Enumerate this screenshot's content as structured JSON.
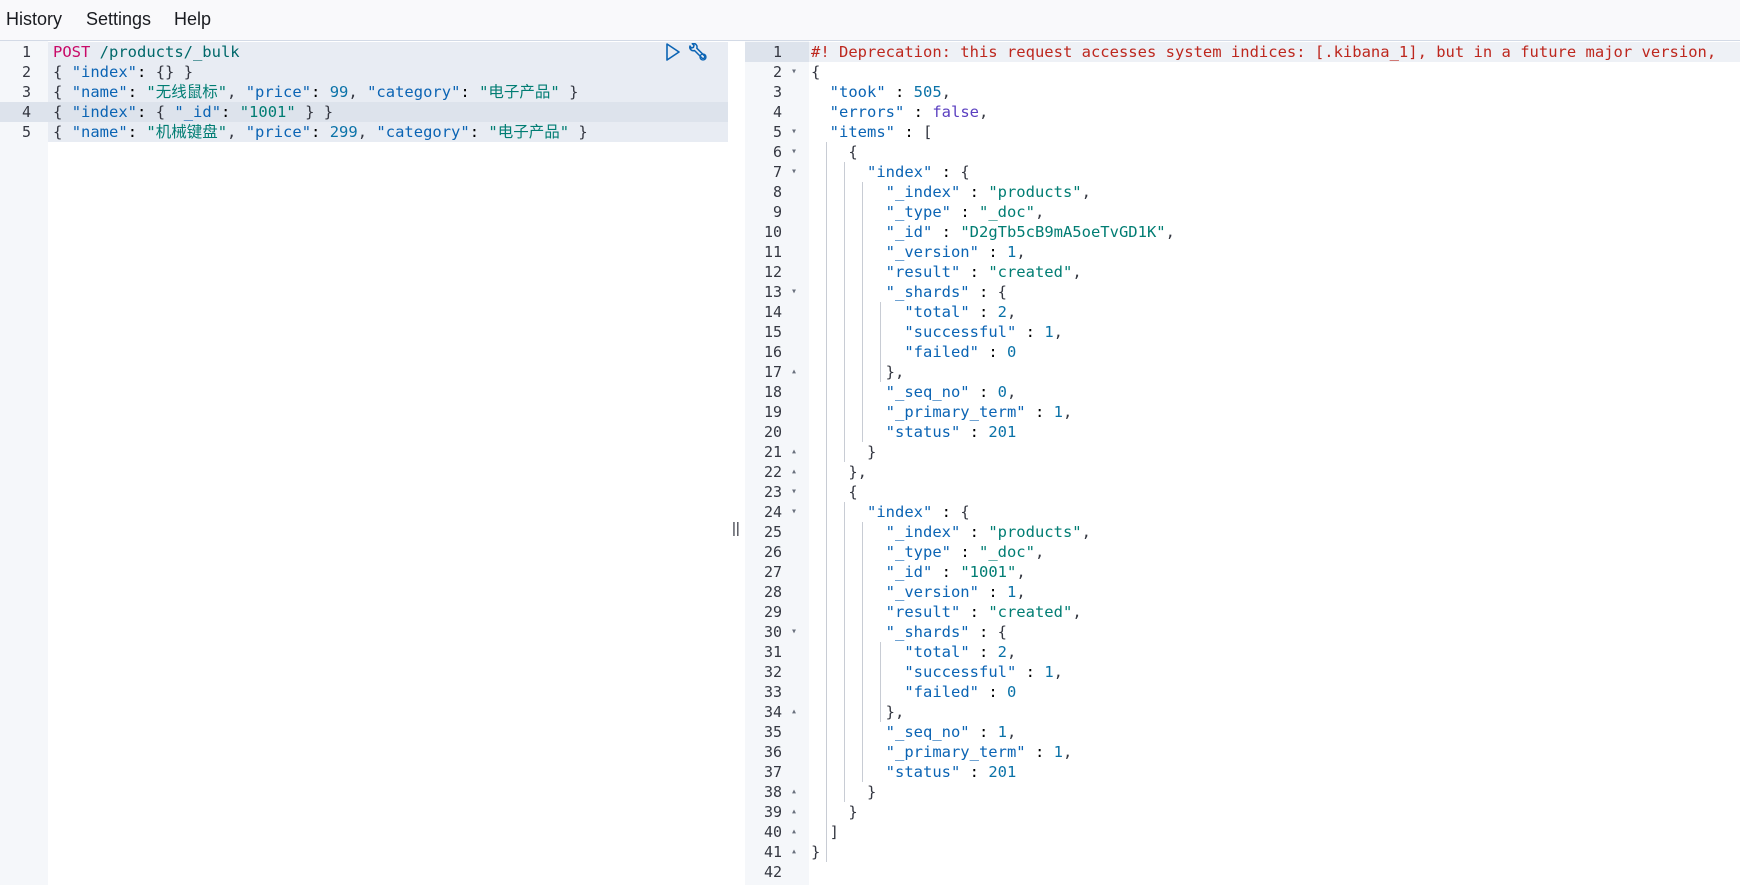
{
  "menubar": {
    "items": [
      "History",
      "Settings",
      "Help"
    ]
  },
  "request": {
    "line_numbers": [
      "1",
      "2",
      "3",
      "4",
      "5"
    ],
    "method": "POST",
    "url": " /products/_bulk",
    "lines": [
      "{ \"index\": {} }",
      "{ \"name\": \"无线鼠标\", \"price\": 99, \"category\": \"电子产品\" }",
      "{ \"index\": { \"_id\": \"1001\" } }",
      "{ \"name\": \"机械键盘\", \"price\": 299, \"category\": \"电子产品\" }"
    ],
    "icons": [
      "play-icon",
      "wrench-icon"
    ]
  },
  "divider": {
    "handle": "||"
  },
  "response": {
    "line_numbers": [
      "1",
      "2",
      "3",
      "4",
      "5",
      "6",
      "7",
      "8",
      "9",
      "10",
      "11",
      "12",
      "13",
      "14",
      "15",
      "16",
      "17",
      "18",
      "19",
      "20",
      "21",
      "22",
      "23",
      "24",
      "25",
      "26",
      "27",
      "28",
      "29",
      "30",
      "31",
      "32",
      "33",
      "34",
      "35",
      "36",
      "37",
      "38",
      "39",
      "40",
      "41",
      "42"
    ],
    "deprecation": "#! Deprecation: this request accesses system indices: [.kibana_1], but in a future major version,",
    "lines": [
      "{",
      "  \"took\" : 505,",
      "  \"errors\" : false,",
      "  \"items\" : [",
      "    {",
      "      \"index\" : {",
      "        \"_index\" : \"products\",",
      "        \"_type\" : \"_doc\",",
      "        \"_id\" : \"D2gTb5cB9mA5oeTvGD1K\",",
      "        \"_version\" : 1,",
      "        \"result\" : \"created\",",
      "        \"_shards\" : {",
      "          \"total\" : 2,",
      "          \"successful\" : 1,",
      "          \"failed\" : 0",
      "        },",
      "        \"_seq_no\" : 0,",
      "        \"_primary_term\" : 1,",
      "        \"status\" : 201",
      "      }",
      "    },",
      "    {",
      "      \"index\" : {",
      "        \"_index\" : \"products\",",
      "        \"_type\" : \"_doc\",",
      "        \"_id\" : \"1001\",",
      "        \"_version\" : 1,",
      "        \"result\" : \"created\",",
      "        \"_shards\" : {",
      "          \"total\" : 2,",
      "          \"successful\" : 1,",
      "          \"failed\" : 0",
      "        },",
      "        \"_seq_no\" : 1,",
      "        \"_primary_term\" : 1,",
      "        \"status\" : 201",
      "      }",
      "    }",
      "  ]",
      "}",
      ""
    ],
    "fold_markers": {
      "2": "down",
      "5": "down",
      "6": "down",
      "7": "down",
      "13": "down",
      "17": "up",
      "21": "up",
      "22": "up",
      "23": "down",
      "24": "down",
      "30": "down",
      "34": "up",
      "38": "up",
      "39": "up",
      "40": "up",
      "41": "up"
    }
  },
  "colors": {
    "method": "#c80a68",
    "string": "#017d73",
    "key": "#0b64b4",
    "number": "#0a72a8",
    "warning": "#bd271e"
  }
}
